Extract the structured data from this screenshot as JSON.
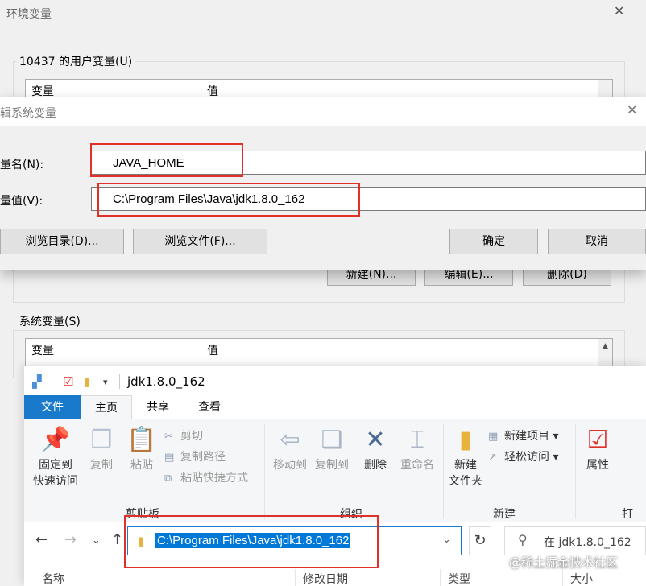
{
  "env_dialog": {
    "title": "环境变量",
    "user_group_label": "10437 的用户变量(U)",
    "system_group_label": "系统变量(S)",
    "col_variable": "变量",
    "col_value": "值",
    "user_buttons": {
      "new": "新建(N)...",
      "edit": "编辑(E)...",
      "delete": "删除(D)"
    }
  },
  "edit_dialog": {
    "title": "辑系统变量",
    "name_label": "量名(N):",
    "value_label": "量值(V):",
    "name_value": "JAVA_HOME",
    "value_value": "C:\\Program Files\\Java\\jdk1.8.0_162",
    "browse_dir": "浏览目录(D)...",
    "browse_file": "浏览文件(F)...",
    "ok": "确定",
    "cancel": "取消"
  },
  "explorer": {
    "window_title": "jdk1.8.0_162",
    "tabs": [
      "文件",
      "主页",
      "共享",
      "查看"
    ],
    "clipboard": {
      "pin_line1": "固定到",
      "pin_line2": "快速访问",
      "copy": "复制",
      "paste": "粘贴",
      "cut": "剪切",
      "copy_path": "复制路径",
      "paste_shortcut": "粘贴快捷方式",
      "label": "剪贴板"
    },
    "organize": {
      "move_to": "移动到",
      "copy_to": "复制到",
      "delete": "删除",
      "rename": "重命名",
      "label": "组织"
    },
    "new": {
      "new_folder_line1": "新建",
      "new_folder_line2": "文件夹",
      "new_item": "新建项目",
      "easy_access": "轻松访问",
      "label": "新建"
    },
    "open": {
      "properties": "属性",
      "label": "打"
    },
    "address": "C:\\Program Files\\Java\\jdk1.8.0_162",
    "search_placeholder": "在 jdk1.8.0_162",
    "columns": [
      "名称",
      "修改日期",
      "类型",
      "大小"
    ]
  },
  "watermark": "@稀土掘金技术社区",
  "colors": {
    "accent": "#1979ca",
    "highlight": "#e0302a",
    "selection": "#0078d7"
  }
}
